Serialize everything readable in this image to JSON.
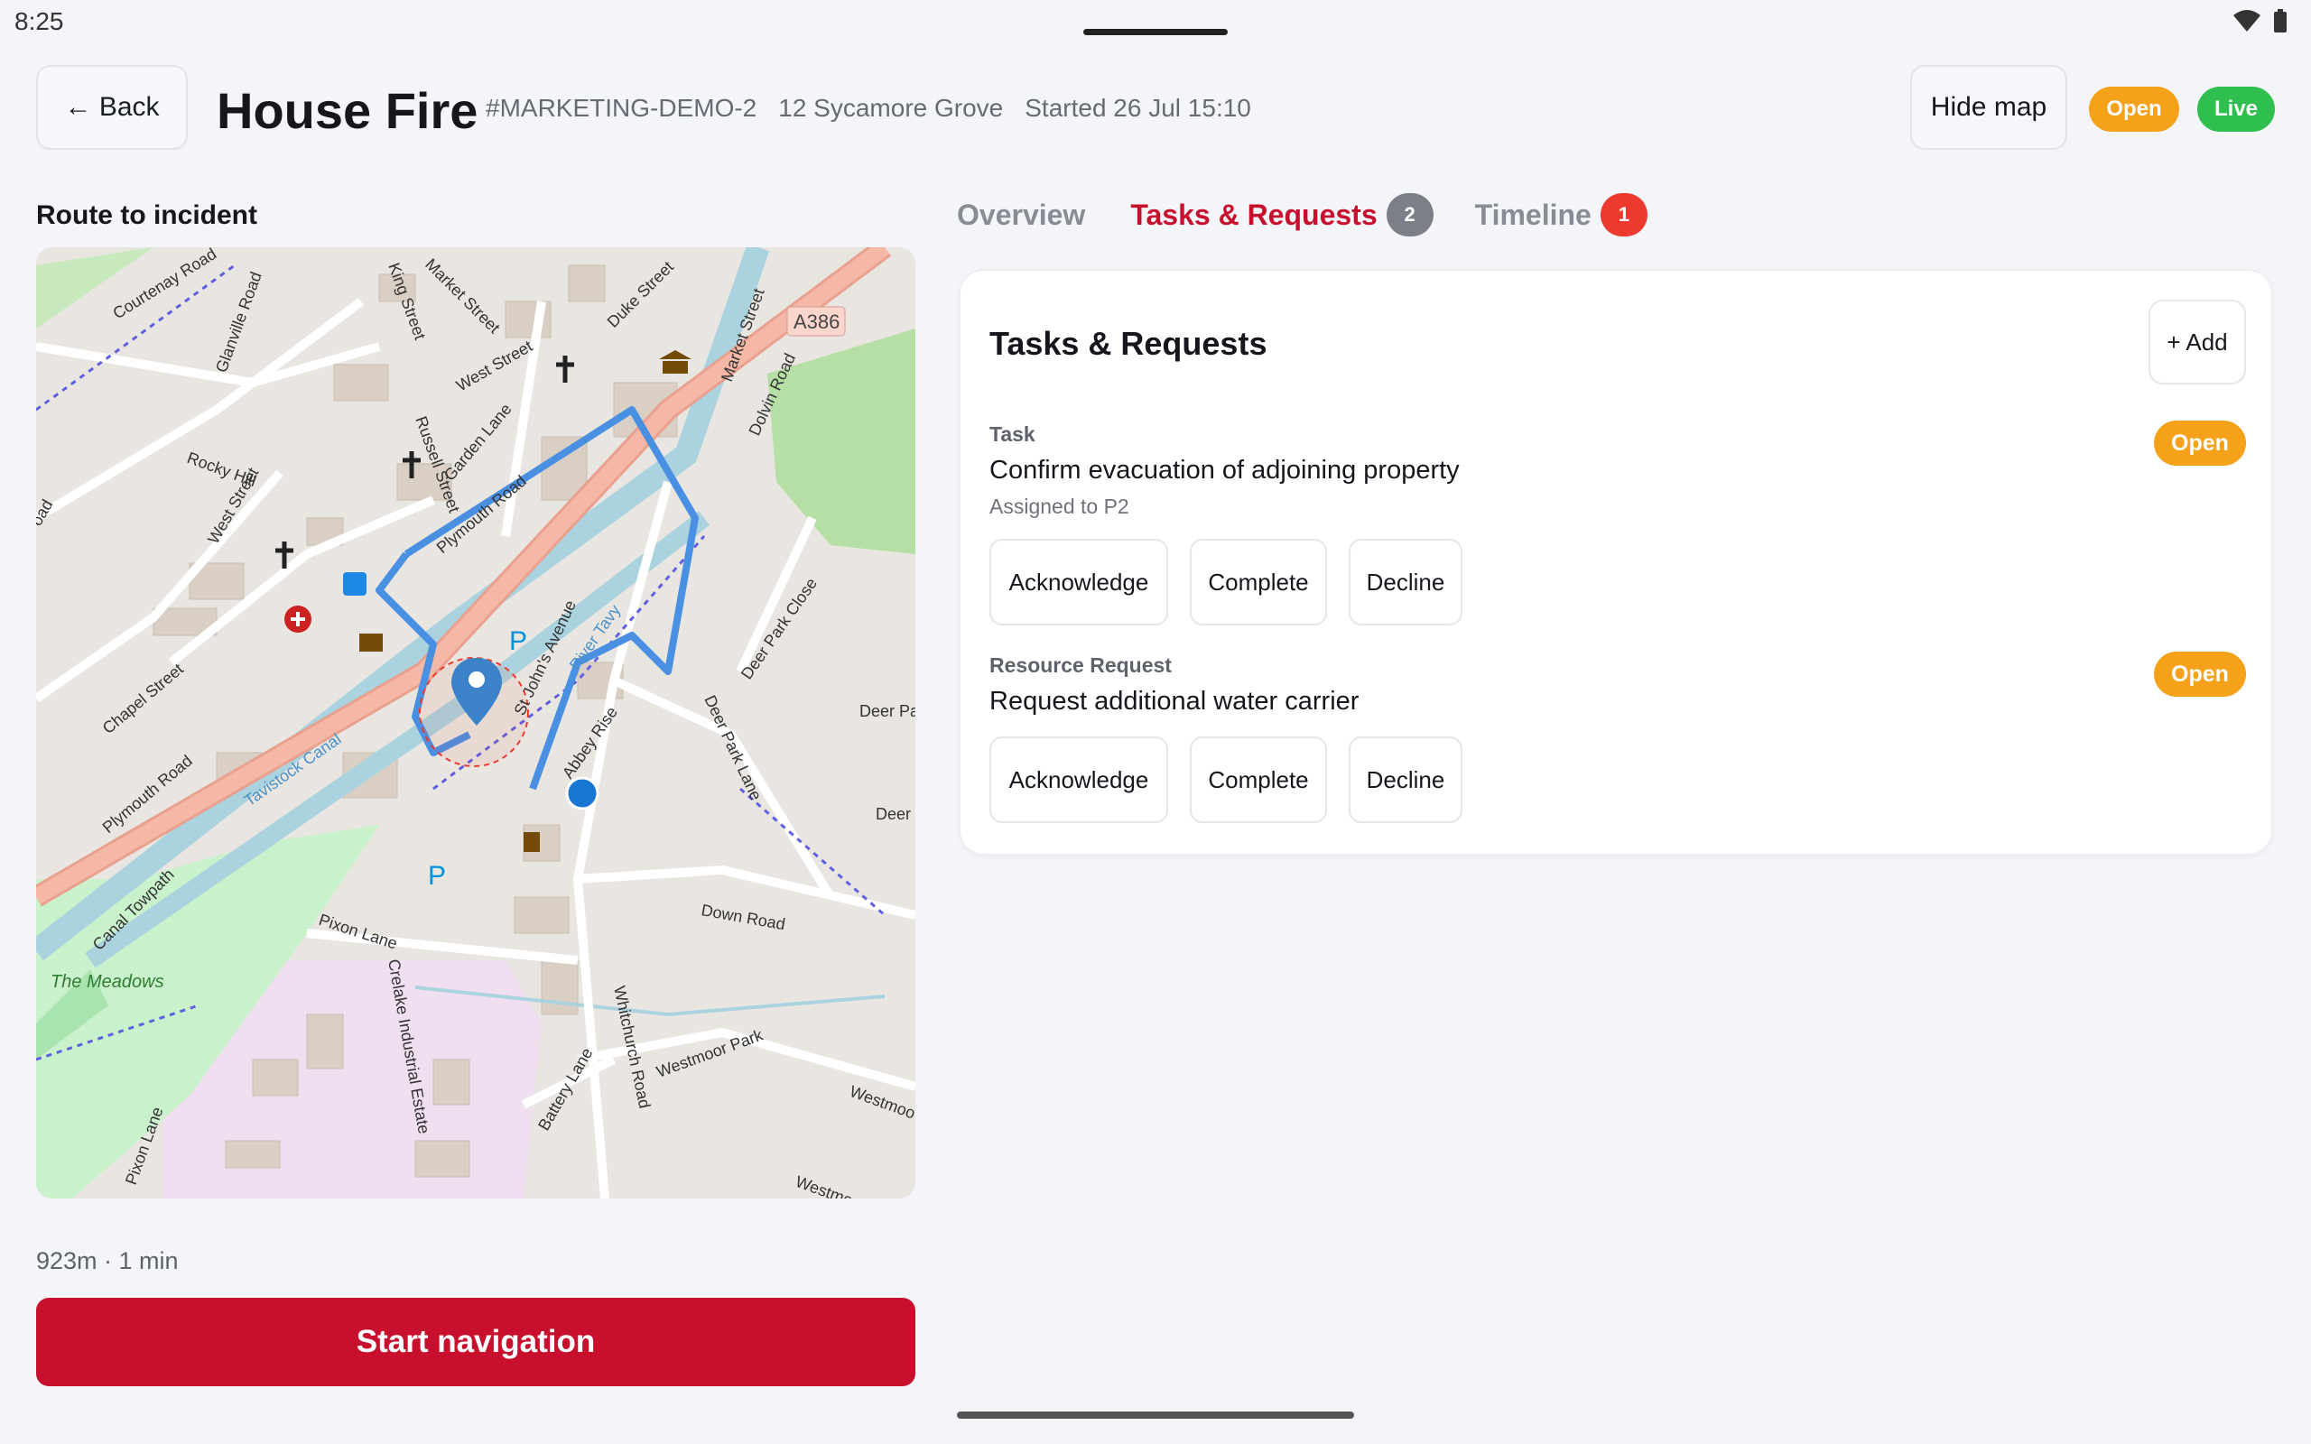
{
  "status_bar": {
    "time": "8:25"
  },
  "header": {
    "back_label": "← Back",
    "title": "House Fire",
    "incident_id": "#MARKETING-DEMO-2",
    "address": "12 Sycamore Grove",
    "started": "Started 26 Jul 15:10",
    "hide_map_label": "Hide map",
    "status_open": "Open",
    "status_live": "Live",
    "colors": {
      "open": "#f5a11a",
      "live": "#2fbf4e",
      "brand": "#c8102e"
    }
  },
  "route": {
    "label": "Route to incident",
    "summary": "923m · 1 min",
    "start_button": "Start navigation"
  },
  "map": {
    "labels": {
      "courtenay_road": "Courtenay Road",
      "glanville_road": "Glanville Road",
      "king_street": "King Street",
      "market_street": "Market Street",
      "duke_street": "Duke Street",
      "market_street_2": "Market Street",
      "a386": "A386",
      "dolvin_road": "Dolvin Road",
      "west_street": "West Street",
      "west_street_2": "West Street",
      "russell_street": "Russell Street",
      "garden_lane": "Garden Lane",
      "rocky_hill": "Rocky Hill",
      "plymouth_road": "Plymouth Road",
      "plymouth_road_2": "Plymouth Road",
      "chapel_street": "Chapel Street",
      "tavistock_canal": "Tavistock Canal",
      "river_tavy": "River Tavy",
      "st_johns_avenue": "St John's Avenue",
      "abbey_rise": "Abbey Rise",
      "deer_park_close": "Deer Park Close",
      "deer_park_lane": "Deer Park Lane",
      "deer_pa": "Deer Pa",
      "deer": "Deer",
      "canal_towpath": "Canal Towpath",
      "the_meadows": "The Meadows",
      "pixon_lane": "Pixon Lane",
      "pixon_lane_2": "Pixon Lane",
      "down_road": "Down Road",
      "crelake_industrial": "Crelake Industrial Estate",
      "whitchurch_road": "Whitchurch Road",
      "battery_lane": "Battery Lane",
      "westmoor_park": "Westmoor Park",
      "westmoo": "Westmoo",
      "westmoor_p": "Westmoor P",
      "oad": "oad",
      "parking": "P"
    }
  },
  "tabs": [
    {
      "label": "Overview",
      "badge": ""
    },
    {
      "label": "Tasks & Requests",
      "badge": "2"
    },
    {
      "label": "Timeline",
      "badge": "1"
    }
  ],
  "panel": {
    "title": "Tasks & Requests",
    "add_label": "+ Add",
    "items": [
      {
        "type": "Task",
        "title": "Confirm evacuation of adjoining property",
        "assigned": "Assigned to P2",
        "status": "Open",
        "actions": [
          "Acknowledge",
          "Complete",
          "Decline"
        ]
      },
      {
        "type": "Resource Request",
        "title": "Request additional water carrier",
        "status": "Open",
        "actions": [
          "Acknowledge",
          "Complete",
          "Decline"
        ]
      }
    ]
  }
}
